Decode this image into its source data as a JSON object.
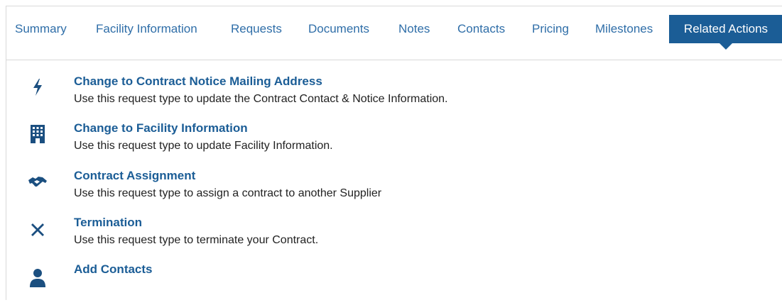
{
  "tabs": [
    {
      "label": "Summary"
    },
    {
      "label": "Facility Information"
    },
    {
      "label": "Requests"
    },
    {
      "label": "Documents"
    },
    {
      "label": "Notes"
    },
    {
      "label": "Contacts"
    },
    {
      "label": "Pricing"
    },
    {
      "label": "Milestones"
    },
    {
      "label": "Related Actions",
      "active": true
    }
  ],
  "actions": [
    {
      "icon": "lightning-bolt-icon",
      "title": "Change to Contract Notice Mailing Address",
      "description": "Use this request type to update the Contract Contact & Notice Information."
    },
    {
      "icon": "building-icon",
      "title": "Change to Facility Information",
      "description": "Use this request type to update Facility Information."
    },
    {
      "icon": "handshake-icon",
      "title": "Contract Assignment",
      "description": "Use this request type to assign a contract to another Supplier"
    },
    {
      "icon": "close-x-icon",
      "title": "Termination",
      "description": "Use this request type to terminate your Contract."
    },
    {
      "icon": "user-icon",
      "title": "Add Contacts",
      "description": ""
    }
  ],
  "colors": {
    "accent": "#1b5d96",
    "tab_text": "#2f6ea8",
    "icon": "#1b4f80",
    "border": "#d9d9d9"
  }
}
